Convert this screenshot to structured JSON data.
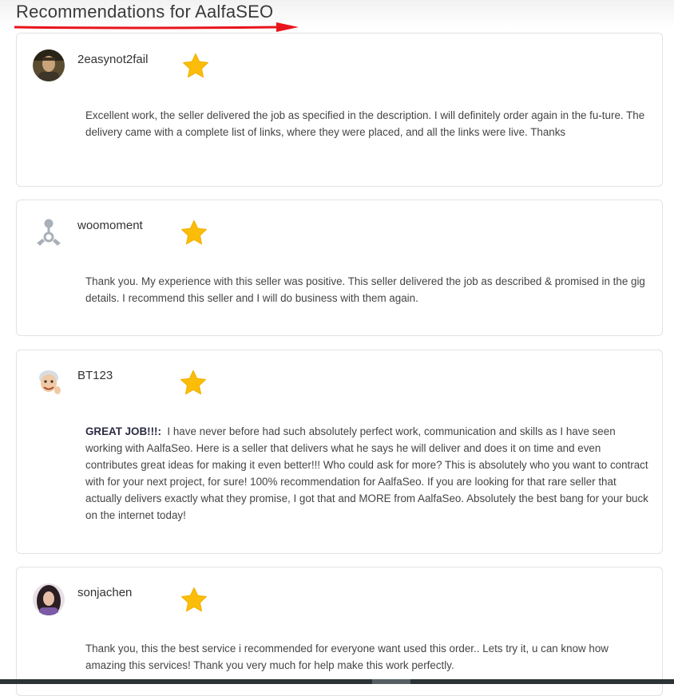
{
  "page": {
    "title": "Recommendations for AalfaSEO",
    "arrow_color": "#e8141b",
    "star_color": "#fbbd08"
  },
  "reviews": [
    {
      "username": "2easynot2fail",
      "avatar_icon": "user-photo",
      "rating_icon": "star-icon",
      "text": "Excellent work, the seller delivered the job as specified in the description. I will definitely order again in the fu-ture. The delivery came with a complete list of links, where they were placed, and all the links were live. Thanks"
    },
    {
      "username": "woomoment",
      "avatar_icon": "default-user-icon",
      "rating_icon": "star-icon",
      "text": "Thank you. My experience with this seller was positive. This seller delivered the job as described & promised in the gig details. I recommend this seller and I will do business with them again."
    },
    {
      "username": "BT123",
      "avatar_icon": "cartoon-avatar",
      "rating_icon": "star-icon",
      "highlight": "GREAT JOB!!!:",
      "text": "I have never before had such absolutely perfect work, communication and skills as I have seen working with AalfaSeo. Here is a seller that delivers what he says he will deliver and does it on time and even contributes great ideas for making it even better!!! Who could ask for more? This is absolutely who you want to contract with for your next project, for sure! 100% recommendation for AalfaSeo. If you are looking for that rare seller that actually delivers exactly what they promise, I got that and MORE from AalfaSeo. Absolutely the best bang for your buck on the internet today!"
    },
    {
      "username": "sonjachen",
      "avatar_icon": "user-photo",
      "rating_icon": "star-icon",
      "text": "Thank you, this the best service i recommended for everyone want used this order.. Lets try it, u can know how amazing this services! Thank you very much for help make this work perfectly."
    }
  ]
}
